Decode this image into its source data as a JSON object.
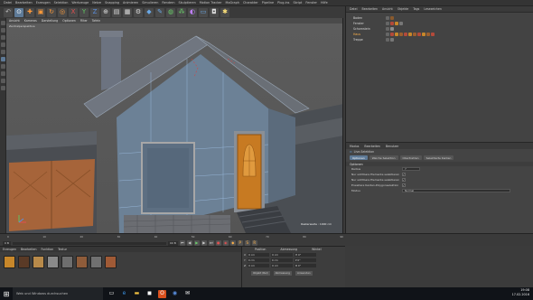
{
  "menubar": {
    "items": [
      "Datei",
      "Bearbeiten",
      "Erzeugen",
      "Selektion",
      "Werkzeuge",
      "Netze",
      "Snapping",
      "Animieren",
      "Simulieren",
      "Rendern",
      "Skulptieren",
      "Motion Tracker",
      "MoGraph",
      "Charakter",
      "Pipeline",
      "Plug-ins",
      "Skript",
      "Fenster",
      "Hilfe"
    ]
  },
  "viewport": {
    "menu": [
      "Ansicht",
      "Kameras",
      "Darstellung",
      "Optionen",
      "Filter",
      "Tafeln"
    ],
    "label": "Zentralperspektive",
    "stat": "Rasterweite : 1000 cm"
  },
  "objects": {
    "menu": [
      "Datei",
      "Bearbeiten",
      "Ansicht",
      "Objekte",
      "Tags",
      "Lesezeichen"
    ],
    "rows": [
      {
        "name": "Boden"
      },
      {
        "name": "Fenster"
      },
      {
        "name": "Schornstein"
      },
      {
        "name": "Haus"
      },
      {
        "name": "Treppe"
      }
    ]
  },
  "attributes": {
    "menu": [
      "Modus",
      "Bearbeiten",
      "Benutzer"
    ],
    "title": "Live-Selektion",
    "tabs": [
      "Optionen",
      "Weiche Selektion",
      "Obertrahlen",
      "Selektierte Kanten"
    ],
    "section": "Optionen",
    "props": [
      {
        "label": "Radius",
        "value": "7"
      },
      {
        "label": "Nur sichtbare Elemente selektieren",
        "value": "✓"
      },
      {
        "label": "Nur sichtbare Elemente selektieren",
        "value": "✓"
      },
      {
        "label": "Erweitere Kanten-Polygonselektion",
        "value": "✓"
      },
      {
        "label": "Modus",
        "value": "Normal"
      }
    ]
  },
  "timeline": {
    "ticks": [
      "0",
      "10",
      "20",
      "30",
      "40",
      "50",
      "60",
      "70",
      "80",
      "90"
    ],
    "frame_start": "0 B",
    "frame_end": "90 B"
  },
  "materials": {
    "menu": [
      "Erzeugen",
      "Bearbeiten",
      "Funktion",
      "Textur"
    ]
  },
  "coordinates": {
    "heads": [
      "Position",
      "Abmessung",
      "Winkel"
    ],
    "rows": [
      {
        "axis": "X",
        "pos": "0 cm",
        "size": "0 cm",
        "ang": "H 0°"
      },
      {
        "axis": "Y",
        "pos": "0 cm",
        "size": "0 cm",
        "ang": "P 0°"
      },
      {
        "axis": "Z",
        "pos": "0 cm",
        "size": "0 cm",
        "ang": "B 0°"
      }
    ],
    "mode": "Objekt (Rel)",
    "size_mode": "Abmessung",
    "apply": "Anwenden"
  },
  "taskbar": {
    "search": "Web und Windows durchsuchen",
    "time": "19:08",
    "date": "17.02.2016"
  },
  "colors": {
    "sky": "#5a5a5a",
    "wall": "#6c8196",
    "roof": "#6d7279",
    "door": "#c77a22",
    "wood": "#9c5f2e",
    "selected": "#ffb34a"
  }
}
